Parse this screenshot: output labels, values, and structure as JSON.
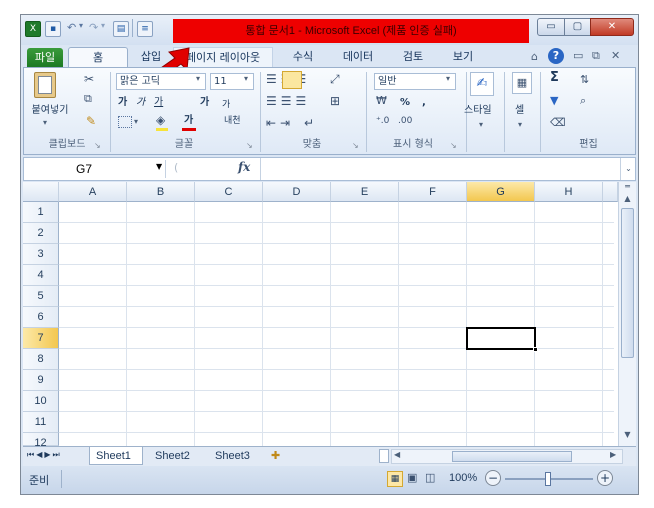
{
  "window": {
    "title": "통합 문서1 - Microsoft Excel (제품 인증 실패)",
    "minimize_glyph": "▭",
    "maximize_glyph": "▢",
    "close_glyph": "✕"
  },
  "ribbon_tabs": [
    "파일",
    "홈",
    "삽입",
    "페이지 레이아웃",
    "수식",
    "데이터",
    "검토",
    "보기"
  ],
  "ribbon": {
    "clipboard": {
      "paste": "붙여넣기",
      "label": "클립보드"
    },
    "font": {
      "name": "맑은 고딕",
      "size": "11",
      "bold": "가",
      "italic": "가",
      "underline": "가",
      "grow": "가",
      "shrink": "가",
      "color_a": "가",
      "phonetic": "내천",
      "label": "글꼴"
    },
    "alignment": {
      "label": "맞춤"
    },
    "number": {
      "format": "일반",
      "percent": "%",
      "comma": ",",
      "label": "표시 형식"
    },
    "styles": {
      "label": "스타일"
    },
    "cells": {
      "label": "셀"
    },
    "editing": {
      "sigma": "Σ",
      "label": "편집"
    }
  },
  "formula_bar": {
    "name_box": "G7",
    "fx": "fx",
    "formula": ""
  },
  "columns": [
    "A",
    "B",
    "C",
    "D",
    "E",
    "F",
    "G",
    "H"
  ],
  "rows": [
    "1",
    "2",
    "3",
    "4",
    "5",
    "6",
    "7",
    "8",
    "9",
    "10",
    "11",
    "12"
  ],
  "active_cell": {
    "column": "G",
    "row": "7"
  },
  "sheets": [
    "Sheet1",
    "Sheet2",
    "Sheet3"
  ],
  "status": {
    "ready": "준비",
    "zoom": "100%"
  },
  "colors": {
    "accent_red": "#ee0000",
    "selected_header": "#f9d770",
    "file_tab": "#2a8a2e"
  }
}
